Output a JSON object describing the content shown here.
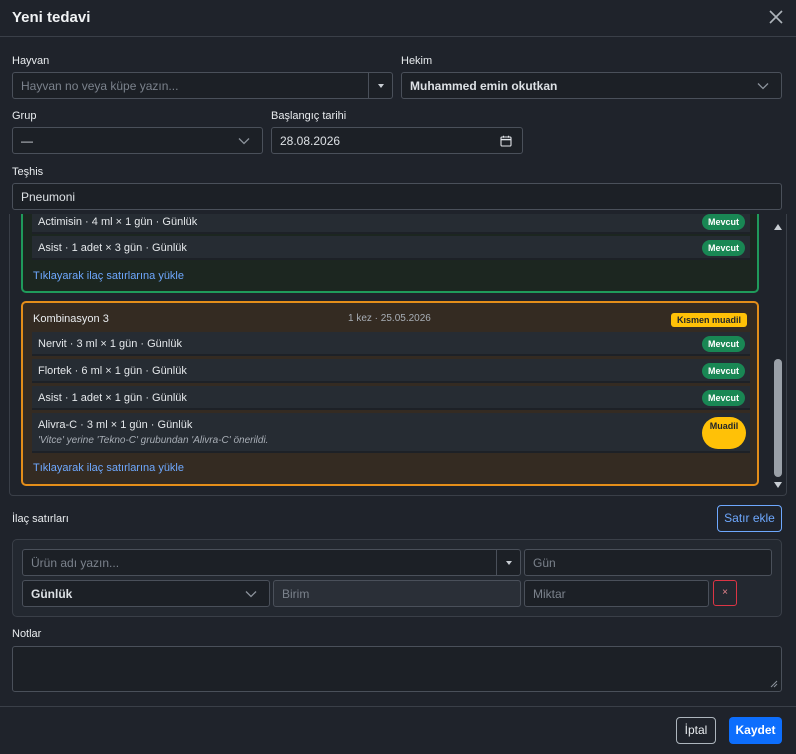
{
  "modal": {
    "title": "Yeni tedavi"
  },
  "form": {
    "animal": {
      "label": "Hayvan",
      "placeholder": "Hayvan no veya küpe yazın..."
    },
    "doctor": {
      "label": "Hekim",
      "value": "Muhammed emin okutkan"
    },
    "group": {
      "label": "Grup",
      "value": "—"
    },
    "start_date": {
      "label": "Başlangıç tarihi",
      "value": "28.08.2026"
    },
    "diagnosis": {
      "label": "Teşhis",
      "value": "Pneumoni"
    }
  },
  "combinations": [
    {
      "color": "#1f9a5b",
      "items": [
        {
          "text": "Actimisin · 4 ml × 1 gün · Günlük",
          "badge": "Mevcut"
        },
        {
          "text": "Asist · 1 adet × 3 gün · Günlük",
          "badge": "Mevcut"
        }
      ],
      "load_link": "Tıklayarak ilaç satırlarına yükle"
    },
    {
      "color": "#e48e1a",
      "name": "Kombinasyon 3",
      "meta": "1 kez · 25.05.2026",
      "status": "Kısmen muadil",
      "items": [
        {
          "text": "Nervit · 3 ml × 1 gün · Günlük",
          "badge": "Mevcut"
        },
        {
          "text": "Flortek · 6 ml × 1 gün · Günlük",
          "badge": "Mevcut"
        },
        {
          "text": "Asist · 1 adet × 1 gün · Günlük",
          "badge": "Mevcut"
        },
        {
          "text": "Alivra-C · 3 ml × 1 gün · Günlük",
          "note": "'Vitce' yerine 'Tekno-C' grubundan 'Alivra-C' önerildi.",
          "badge": "Muadil"
        }
      ],
      "load_link": "Tıklayarak ilaç satırlarına yükle"
    }
  ],
  "drug_lines": {
    "label": "İlaç satırları",
    "add_button": "Satır ekle",
    "product_placeholder": "Ürün adı yazın...",
    "day_placeholder": "Gün",
    "frequency_value": "Günlük",
    "unit_placeholder": "Birim",
    "amount_placeholder": "Miktar",
    "remove_label": "×"
  },
  "notes": {
    "label": "Notlar"
  },
  "footer": {
    "cancel": "İptal",
    "save": "Kaydet"
  },
  "colors": {
    "accent": "#0d6efd",
    "success": "#198754",
    "warning": "#ffc107"
  }
}
